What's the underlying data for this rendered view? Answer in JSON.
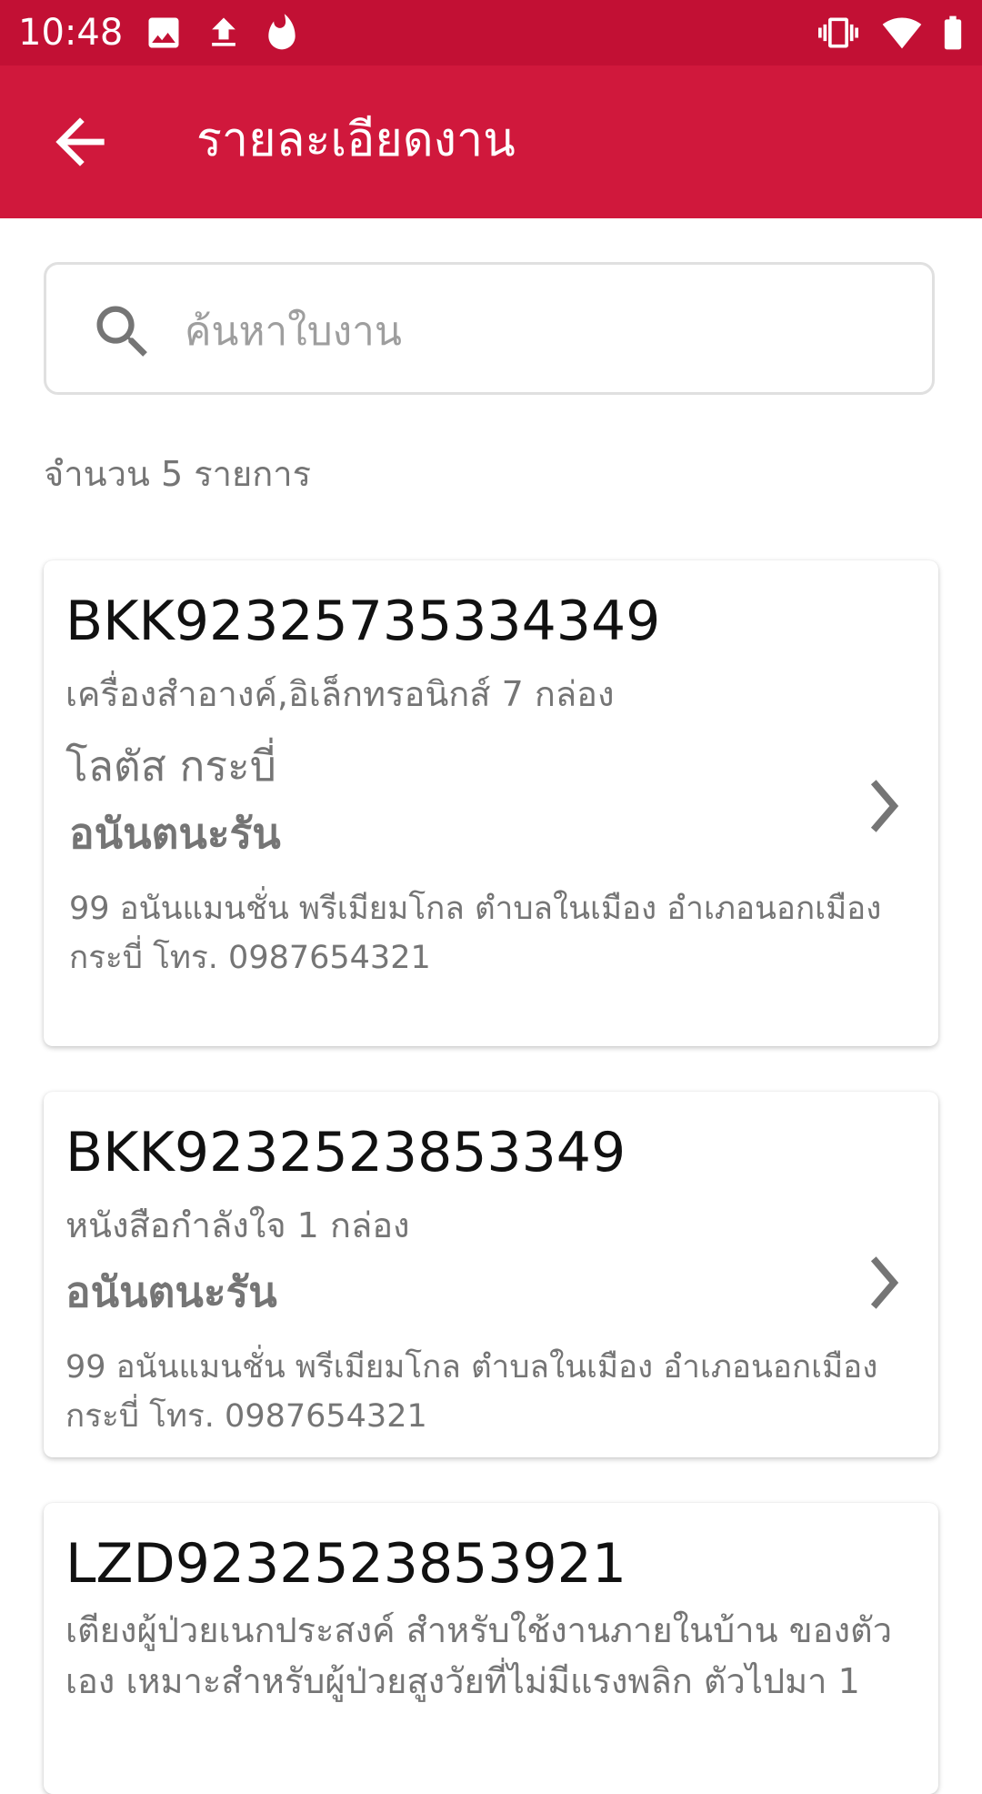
{
  "status_bar": {
    "time": "10:48",
    "icons_left": [
      "image-icon",
      "upload-icon",
      "fire-icon"
    ],
    "icons_right": [
      "vibrate-icon",
      "wifi-icon",
      "battery-icon"
    ]
  },
  "app_bar": {
    "title": "รายละเอียดงาน",
    "back_icon": "arrow-left-icon"
  },
  "colors": {
    "status_bar": "#c21034",
    "app_bar": "#d0183c",
    "secondary_text": "#757575"
  },
  "search": {
    "placeholder": "ค้นหาใบงาน",
    "value": ""
  },
  "count_label": "จำนวน 5 รายการ",
  "cards": [
    {
      "tracking": "BKK92325735334349",
      "description": "เครื่องสำอางค์,อิเล็กทรอนิกส์ 7 กล่อง",
      "store": "โลตัส กระบี่",
      "name": "อนันตนะรัน",
      "address": "99 อนันแมนชั่น พรีเมียมโกล ตำบลในเมือง อำเภอนอกเมือง กระบี่ โทร. 0987654321"
    },
    {
      "tracking": "BKK9232523853349",
      "description": "หนังสือกำลังใจ 1 กล่อง",
      "name": "อนันตนะรัน",
      "address": "99 อนันแมนชั่น พรีเมียมโกล ตำบลในเมือง อำเภอนอกเมือง กระบี่ โทร. 0987654321"
    },
    {
      "tracking": "LZD9232523853921",
      "description": "เตียงผู้ป่วยเนกประสงค์ สำหรับใช้งานภายในบ้าน ของตัวเอง เหมาะสำหรับผู้ป่วยสูงวัยที่ไม่มีแรงพลิก ตัวไปมา 1"
    }
  ]
}
